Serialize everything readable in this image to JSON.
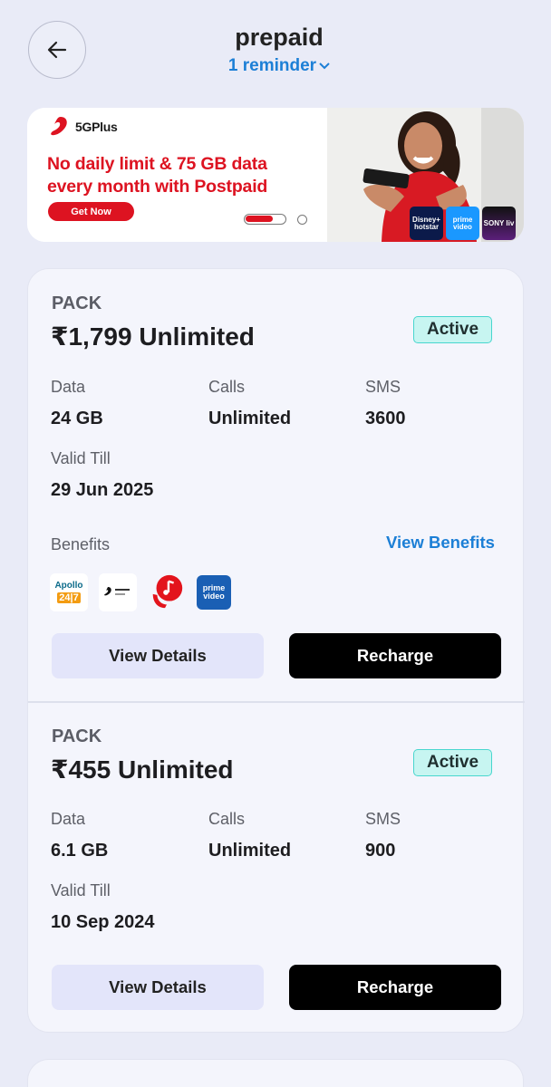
{
  "header": {
    "title": "prepaid",
    "reminder": "1 reminder"
  },
  "banner": {
    "brand": "5GPlus",
    "headline_line1": "No daily limit & 75 GB data",
    "headline_line2": "every month with Postpaid",
    "cta": "Get Now",
    "ott": [
      {
        "name": "hotstar",
        "label": "Disney+ hotstar"
      },
      {
        "name": "prime-video",
        "label": "prime video"
      },
      {
        "name": "sony-liv",
        "label": "SONY liv"
      }
    ]
  },
  "packs": [
    {
      "label": "PACK",
      "name": "₹1,799 Unlimited",
      "status": "Active",
      "data_label": "Data",
      "data_value": "24 GB",
      "calls_label": "Calls",
      "calls_value": "Unlimited",
      "sms_label": "SMS",
      "sms_value": "3600",
      "valid_label": "Valid Till",
      "valid_value": "29 Jun 2025",
      "benefits_label": "Benefits",
      "view_benefits": "View Benefits",
      "benefit_icons": [
        "apollo-24-7-icon",
        "xstream-play-icon",
        "wynk-music-icon",
        "prime-video-icon"
      ],
      "details_button": "View Details",
      "recharge_button": "Recharge"
    },
    {
      "label": "PACK",
      "name": "₹455 Unlimited",
      "status": "Active",
      "data_label": "Data",
      "data_value": "6.1 GB",
      "calls_label": "Calls",
      "calls_value": "Unlimited",
      "sms_label": "SMS",
      "sms_value": "900",
      "valid_label": "Valid Till",
      "valid_value": "10 Sep 2024",
      "details_button": "View Details",
      "recharge_button": "Recharge"
    }
  ],
  "colors": {
    "accent_blue": "#1c7fd6",
    "brand_red": "#dd1321",
    "active_bg": "#c7f5f1",
    "page_bg": "#e9ebf7"
  }
}
